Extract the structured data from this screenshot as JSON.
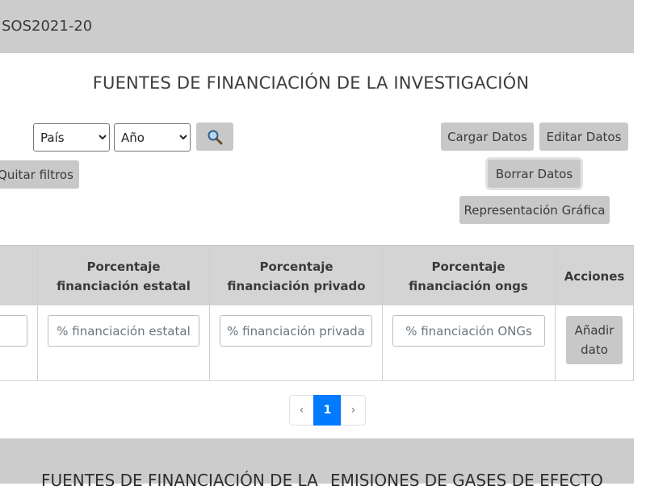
{
  "header": {
    "brand": "SOS2021-20"
  },
  "page": {
    "title": "FUENTES DE FINANCIACIÓN DE LA INVESTIGACIÓN"
  },
  "filters": {
    "country_selected": "País",
    "year_selected": "Año",
    "search_icon": "search-icon",
    "clear_label": "Quitar filtros"
  },
  "actions": {
    "load": "Cargar Datos",
    "edit": "Editar Datos",
    "delete": "Borrar Datos",
    "chart": "Representación Gráfica"
  },
  "table": {
    "headers": [
      "Porcentaje financiación estatal",
      "Porcentaje financiación privado",
      "Porcentaje financiación ongs",
      "Acciones"
    ],
    "placeholders": {
      "state": "% financiación estatal",
      "private": "% financiación privada",
      "ngo": "% financiación ONGs"
    },
    "add_button": "Añadir dato"
  },
  "pagination": {
    "prev": "‹",
    "current": "1",
    "next": "›"
  },
  "footer": {
    "items": [
      "FUENTES DE FINANCIACIÓN DE LA",
      "EMISIONES DE GASES DE EFECTO"
    ]
  },
  "colors": {
    "accent": "#007bff",
    "header_gray": "#cccccc",
    "button_gray": "#c8c8c8"
  }
}
